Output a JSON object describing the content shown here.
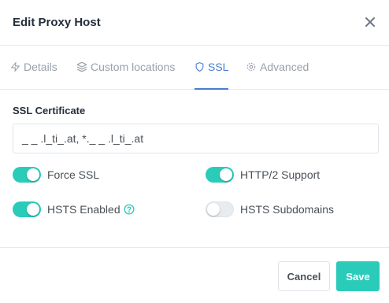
{
  "modal": {
    "title": "Edit Proxy Host",
    "close_icon": "close-icon"
  },
  "tabs": [
    {
      "label": "Details",
      "icon": "bolt-icon",
      "active": false
    },
    {
      "label": "Custom locations",
      "icon": "layers-icon",
      "active": false
    },
    {
      "label": "SSL",
      "icon": "shield-icon",
      "active": true
    },
    {
      "label": "Advanced",
      "icon": "gear-icon",
      "active": false
    }
  ],
  "ssl": {
    "certificate_label": "SSL Certificate",
    "certificate_value": "_ _ .l_ti_.at, *._ _ .l_ti_.at",
    "options": [
      {
        "label": "Force SSL",
        "enabled": true
      },
      {
        "label": "HTTP/2 Support",
        "enabled": true
      },
      {
        "label": "HSTS Enabled",
        "enabled": true,
        "help_icon": "question-circle-icon"
      },
      {
        "label": "HSTS Subdomains",
        "enabled": false
      }
    ]
  },
  "footer": {
    "cancel_label": "Cancel",
    "save_label": "Save"
  },
  "colors": {
    "accent": "#2bcbba",
    "active_tab": "#467fcf",
    "muted": "#9aa0ac"
  }
}
